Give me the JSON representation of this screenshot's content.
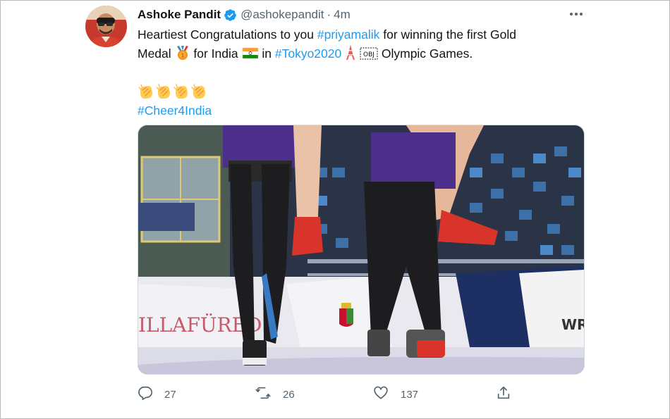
{
  "tweet": {
    "author": {
      "display_name": "Ashoke Pandit",
      "handle": "@ashokepandit",
      "separator": "·",
      "time": "4m",
      "verified": true
    },
    "text": {
      "line1_a": "Heartiest Congratulations to you ",
      "line1_mention": "#priyamalik",
      "line1_b": " for winning the first Gold",
      "line2_a": "Medal ",
      "line2_b": " for India ",
      "line2_c": " in ",
      "line2_hashtag": "#Tokyo2020",
      "line2_d": " ",
      "line2_obj": "OBJ",
      "line2_e": " Olympic Games.",
      "hashtag_cheer": "#Cheer4India"
    },
    "emojis": [
      "medal-emoji",
      "india-flag-emoji",
      "tokyo-tower-emoji",
      "clapping-hands-emoji"
    ],
    "media": {
      "banner_text_left": "ILLAFÜRED",
      "banner_text_right": "WR"
    },
    "actions": {
      "reply_count": "27",
      "retweet_count": "26",
      "like_count": "137"
    }
  },
  "colors": {
    "link": "#1d9bf0",
    "verified": "#1d9bf0",
    "secondary_text": "#536471",
    "border": "#cfd9de"
  }
}
